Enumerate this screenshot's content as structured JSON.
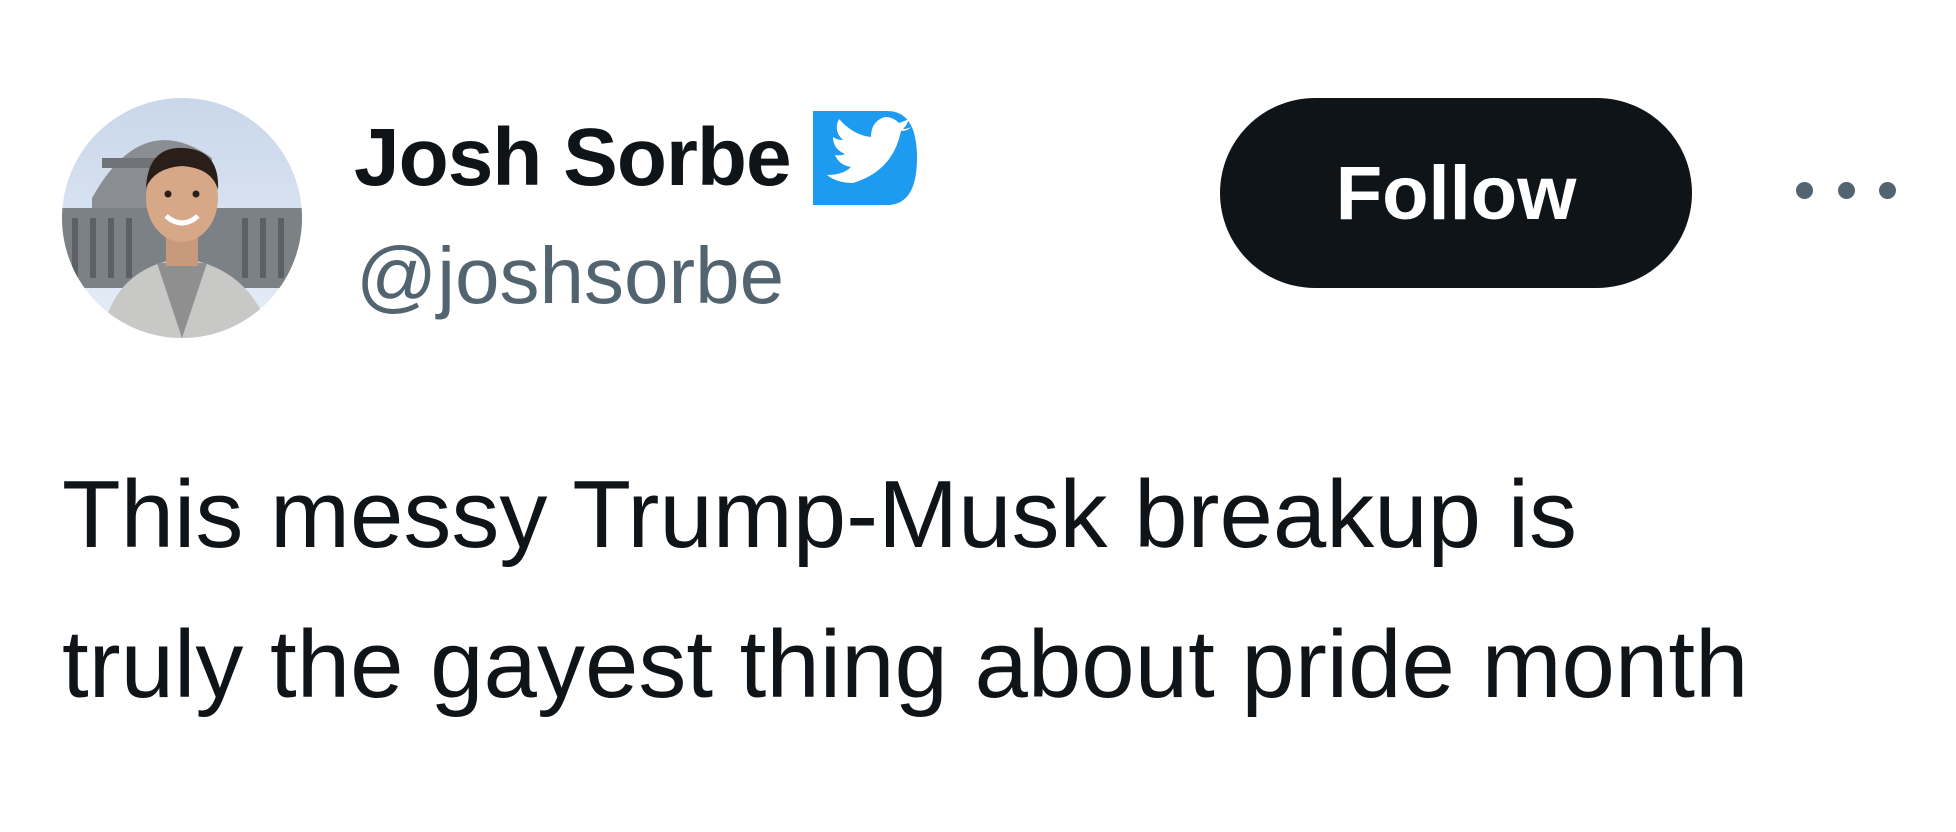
{
  "tweet": {
    "author": {
      "display_name": "Josh Sorbe",
      "handle": "@joshsorbe",
      "verified": true,
      "avatar_icon": "profile-photo"
    },
    "follow_label": "Follow",
    "more_icon": "more-dots-icon",
    "text_lines": [
      "This messy Trump-Musk breakup is",
      "truly the gayest thing about pride month"
    ]
  },
  "colors": {
    "text_primary": "#0f1419",
    "text_secondary": "#536471",
    "verified_blue": "#1d9bf0",
    "follow_bg": "#0f1419",
    "follow_text": "#ffffff",
    "background": "#ffffff"
  }
}
